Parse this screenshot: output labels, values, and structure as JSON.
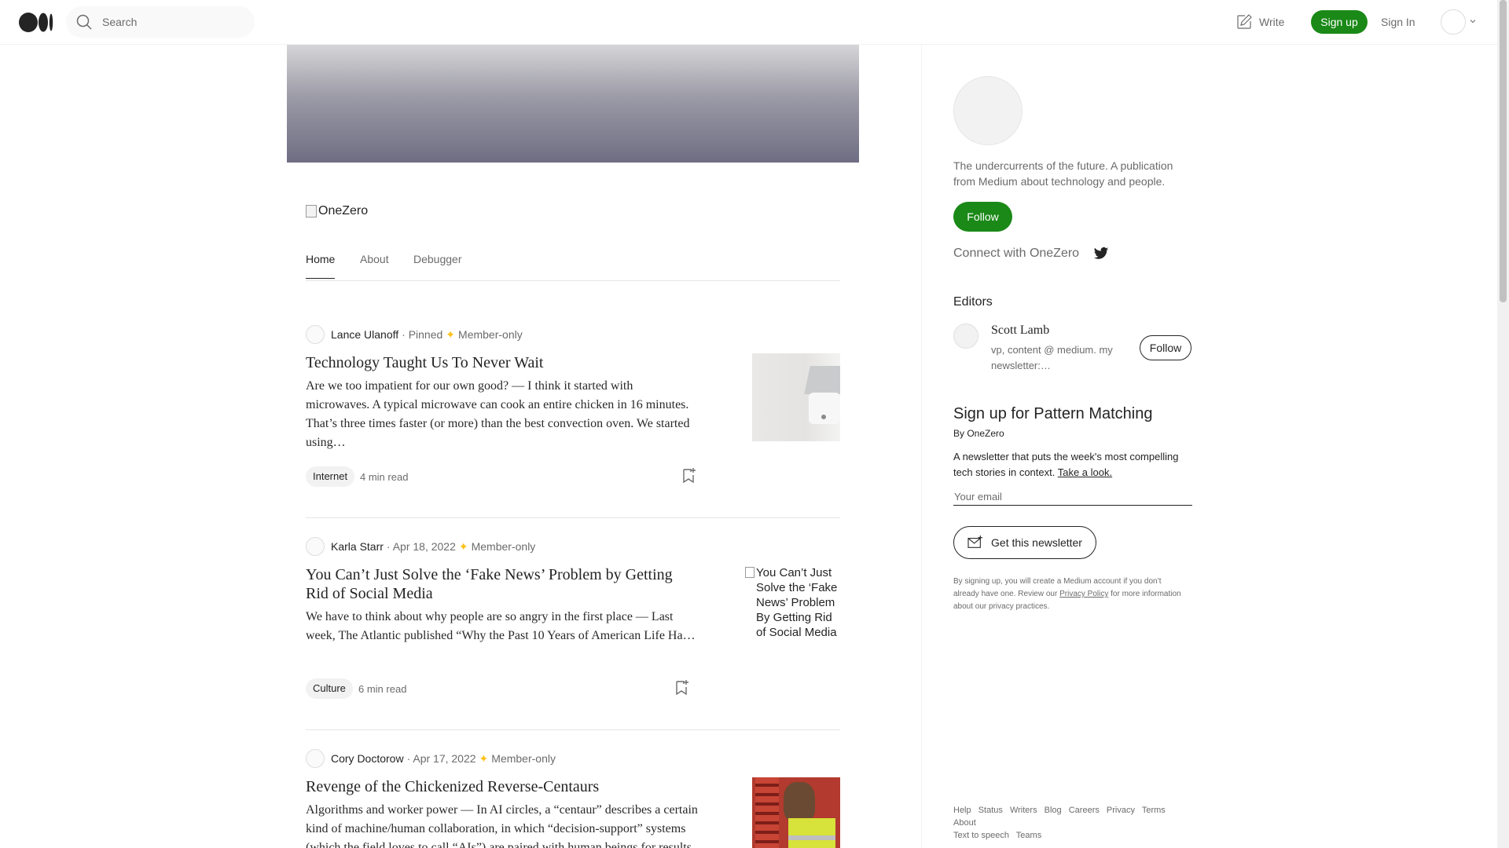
{
  "header": {
    "search_placeholder": "Search",
    "write_label": "Write",
    "signup_label": "Sign up",
    "signin_label": "Sign In",
    "brand_color": "#1a8917"
  },
  "publication": {
    "name_alt": "OneZero",
    "tabs": [
      {
        "label": "Home",
        "active": true
      },
      {
        "label": "About",
        "active": false
      },
      {
        "label": "Debugger",
        "active": false
      }
    ]
  },
  "articles": [
    {
      "author": "Lance Ulanoff",
      "dateline": "· Pinned",
      "badge": "Member-only",
      "title": "Technology Taught Us To Never Wait",
      "excerpt": "Are we too impatient for our own good? — I think it started with microwaves. A typical microwave can cook an entire chicken in 16 minutes. That’s three times faster (or more) than the best convection oven. We started using…",
      "tag": "Internet",
      "read_time": "4 min read"
    },
    {
      "author": "Karla Starr",
      "dateline": "· Apr 18, 2022",
      "badge": "Member-only",
      "title": "You Can’t Just Solve the ‘Fake News’ Problem by Getting Rid of Social Media",
      "excerpt": "We have to think about why people are so angry in the first place — Last week, The Atlantic published “Why the Past 10 Years of American Life Ha…",
      "tag": "Culture",
      "read_time": "6 min read",
      "image_alt": "You Can’t Just Solve the ‘Fake News’ Problem By Getting Rid of Social Media"
    },
    {
      "author": "Cory Doctorow",
      "dateline": "· Apr 17, 2022",
      "badge": "Member-only",
      "title": "Revenge of the Chickenized Reverse-Centaurs",
      "excerpt": "Algorithms and worker power — In AI circles, a “centaur” describes a certain kind of machine/human collaboration, in which “decision-support” systems (which the field loves to call “AIs”) are paired with human beings for results"
    }
  ],
  "sidebar": {
    "description": "The undercurrents of the future. A publication from Medium about technology and people.",
    "follow_label": "Follow",
    "connect_label": "Connect with OneZero",
    "editors_heading": "Editors",
    "editor": {
      "name": "Scott Lamb",
      "bio": "vp, content @ medium. my newsletter:…",
      "follow_label": "Follow"
    },
    "newsletter": {
      "title": "Sign up for Pattern Matching",
      "by": "By OneZero",
      "description": "A newsletter that puts the week's most compelling tech stories in context.",
      "link": "Take a look.",
      "email_placeholder": "Your email",
      "button_label": "Get this newsletter",
      "legal_before": "By signing up, you will create a Medium account if you don’t already have one. Review our",
      "legal_link": "Privacy Policy",
      "legal_after": "for more information about our privacy practices."
    },
    "footer_links": [
      "Help",
      "Status",
      "Writers",
      "Blog",
      "Careers",
      "Privacy",
      "Terms",
      "About",
      "Text to speech",
      "Teams"
    ]
  }
}
